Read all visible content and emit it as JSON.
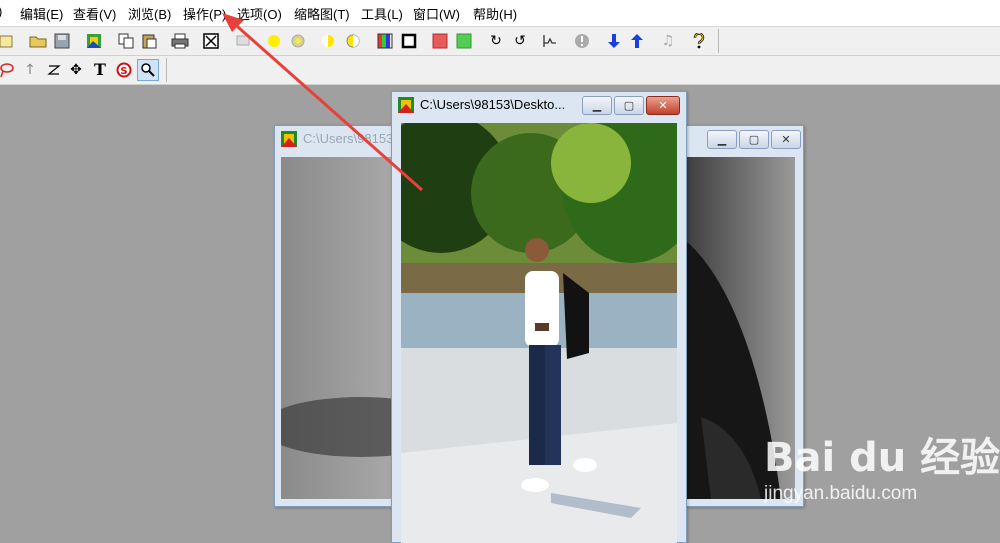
{
  "menu": {
    "items": [
      {
        "label": "编辑(E)"
      },
      {
        "label": "查看(V)"
      },
      {
        "label": "浏览(B)"
      },
      {
        "label": "操作(P)"
      },
      {
        "label": "选项(O)"
      },
      {
        "label": "缩略图(T)"
      },
      {
        "label": "工具(L)"
      },
      {
        "label": "窗口(W)"
      },
      {
        "label": "帮助(H)"
      }
    ]
  },
  "toolbar2": {
    "text_tool_glyph": "T"
  },
  "window_back": {
    "title": "C:\\Users\\98153"
  },
  "window_front": {
    "title": "C:\\Users\\98153\\Deskto..."
  },
  "watermark": {
    "logo": "Bai du 经验",
    "url": "jingyan.baidu.com"
  }
}
